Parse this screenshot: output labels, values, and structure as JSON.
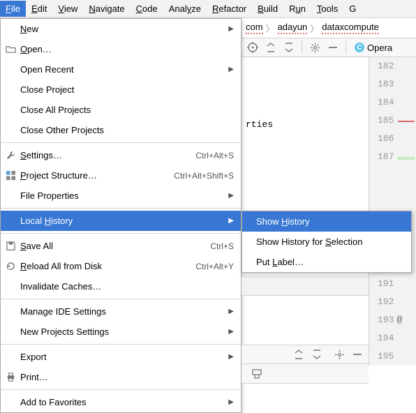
{
  "menubar": {
    "items": [
      {
        "label": "File",
        "mnemonic": 0,
        "active": true
      },
      {
        "label": "Edit",
        "mnemonic": 0
      },
      {
        "label": "View",
        "mnemonic": 0
      },
      {
        "label": "Navigate",
        "mnemonic": 0
      },
      {
        "label": "Code",
        "mnemonic": 0
      },
      {
        "label": "Analyze",
        "mnemonic": 4
      },
      {
        "label": "Refactor",
        "mnemonic": 0
      },
      {
        "label": "Build",
        "mnemonic": 0
      },
      {
        "label": "Run",
        "mnemonic": 1
      },
      {
        "label": "Tools",
        "mnemonic": 0
      },
      {
        "label": "G"
      }
    ]
  },
  "breadcrumbs": {
    "items": [
      "com",
      "adayun",
      "dataxcompute"
    ]
  },
  "active_tab": {
    "letter": "C",
    "label": "Opera"
  },
  "file_menu": {
    "groups": [
      [
        {
          "label": "New",
          "mnemonic": 0,
          "sub": true
        },
        {
          "label": "Open…",
          "mnemonic": 0,
          "icon": "folder-open-icon"
        },
        {
          "label": "Open Recent",
          "sub": true
        },
        {
          "label": "Close Project"
        },
        {
          "label": "Close All Projects"
        },
        {
          "label": "Close Other Projects"
        }
      ],
      [
        {
          "label": "Settings…",
          "mnemonic": 0,
          "icon": "wrench-icon",
          "shortcut": "Ctrl+Alt+S"
        },
        {
          "label": "Project Structure…",
          "mnemonic": 0,
          "icon": "project-structure-icon",
          "shortcut": "Ctrl+Alt+Shift+S"
        },
        {
          "label": "File Properties",
          "sub": true
        }
      ],
      [
        {
          "label": "Local History",
          "mnemonic": 6,
          "sub": true,
          "highlight": true
        }
      ],
      [
        {
          "label": "Save All",
          "mnemonic": 0,
          "icon": "save-icon",
          "shortcut": "Ctrl+S"
        },
        {
          "label": "Reload All from Disk",
          "mnemonic": 0,
          "icon": "reload-icon",
          "shortcut": "Ctrl+Alt+Y"
        },
        {
          "label": "Invalidate Caches…"
        }
      ],
      [
        {
          "label": "Manage IDE Settings",
          "sub": true
        },
        {
          "label": "New Projects Settings",
          "sub": true
        }
      ],
      [
        {
          "label": "Export",
          "sub": true
        },
        {
          "label": "Print…",
          "icon": "print-icon"
        }
      ],
      [
        {
          "label": "Add to Favorites",
          "sub": true
        }
      ]
    ]
  },
  "local_history_submenu": {
    "items": [
      {
        "label": "Show History",
        "mnemonic": 5,
        "highlight": true
      },
      {
        "label": "Show History for Selection",
        "mnemonic": 17
      },
      {
        "label": "Put Label…",
        "mnemonic": 4
      }
    ]
  },
  "editor_fragments": {
    "line_rties": "rties"
  },
  "gutter": {
    "lines_top": [
      "182",
      "183",
      "184",
      "185",
      "186",
      "187"
    ],
    "lines_bottom": [
      "191",
      "192",
      "193",
      "194",
      "195"
    ],
    "at_symbol_line": "193",
    "red_mark_line": "185",
    "green_mark_line": "187"
  }
}
